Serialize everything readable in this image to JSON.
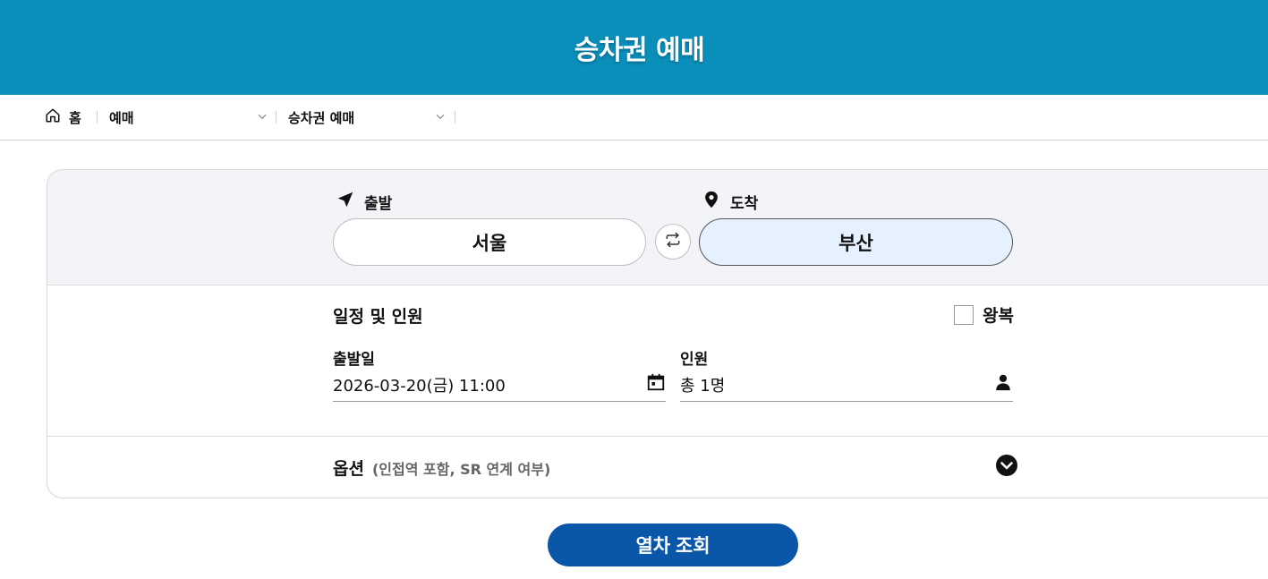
{
  "header": {
    "title": "승차권 예매"
  },
  "breadcrumb": {
    "home_label": "홈",
    "level1": "예매",
    "level2": "승차권 예매"
  },
  "route": {
    "departure_label": "출발",
    "departure_value": "서울",
    "arrival_label": "도착",
    "arrival_value": "부산"
  },
  "schedule": {
    "section_title": "일정 및 인원",
    "roundtrip_label": "왕복",
    "roundtrip_checked": false,
    "date_label": "출발일",
    "date_value": "2026-03-20(금) 11:00",
    "people_label": "인원",
    "people_value": "총 1명"
  },
  "options": {
    "title": "옵션",
    "subtitle": "(인접역 포함, SR 연계 여부)"
  },
  "actions": {
    "search_label": "열차 조회"
  },
  "colors": {
    "banner": "#0a8fbb",
    "primary_button": "#0a56a8",
    "arrival_bg": "#e6f1ff",
    "panel_bg": "#f3f4f8"
  },
  "icons": {
    "home": "home-icon",
    "chevron": "chevron-down-icon",
    "departure": "navigation-arrow-icon",
    "arrival": "map-pin-icon",
    "swap": "swap-icon",
    "calendar": "calendar-icon",
    "person": "person-icon",
    "options_toggle": "chevron-circle-down-icon"
  }
}
